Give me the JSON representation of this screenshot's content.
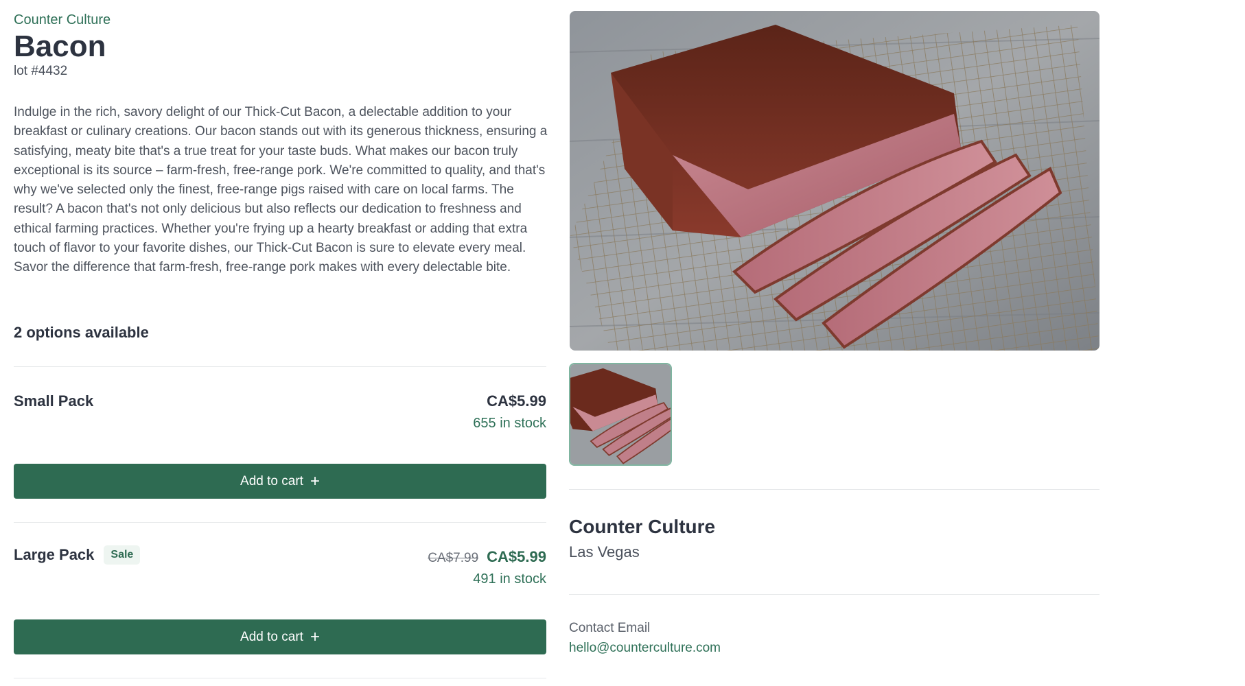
{
  "vendor": {
    "name": "Counter Culture"
  },
  "product": {
    "title": "Bacon",
    "lot": "lot #4432",
    "description": "Indulge in the rich, savory delight of our Thick-Cut Bacon, a delectable addition to your breakfast or culinary creations. Our bacon stands out with its generous thickness, ensuring a satisfying, meaty bite that's a true treat for your taste buds. What makes our bacon truly exceptional is its source – farm-fresh, free-range pork. We're committed to quality, and that's why we've selected only the finest, free-range pigs raised with care on local farms. The result? A bacon that's not only delicious but also reflects our dedication to freshness and ethical farming practices. Whether you're frying up a hearty breakfast or adding that extra touch of flavor to your favorite dishes, our Thick-Cut Bacon is sure to elevate every meal. Savor the difference that farm-fresh, free-range pork makes with every delectable bite."
  },
  "options": {
    "heading": "2 options available",
    "items": [
      {
        "name": "Small Pack",
        "price": "CA$5.99",
        "stock": "655 in stock",
        "button_label": "Add to cart"
      },
      {
        "name": "Large Pack",
        "badge": "Sale",
        "original_price": "CA$7.99",
        "price": "CA$5.99",
        "stock": "491 in stock",
        "button_label": "Add to cart"
      }
    ]
  },
  "shop": {
    "name": "Counter Culture",
    "city": "Las Vegas",
    "contact_label": "Contact Email",
    "contact_email": "hello@counterculture.com"
  },
  "icons": {
    "add": "plus-icon"
  },
  "colors": {
    "accent": "#2e6b52",
    "accent_text": "#2e7057",
    "heading": "#2d3340"
  }
}
